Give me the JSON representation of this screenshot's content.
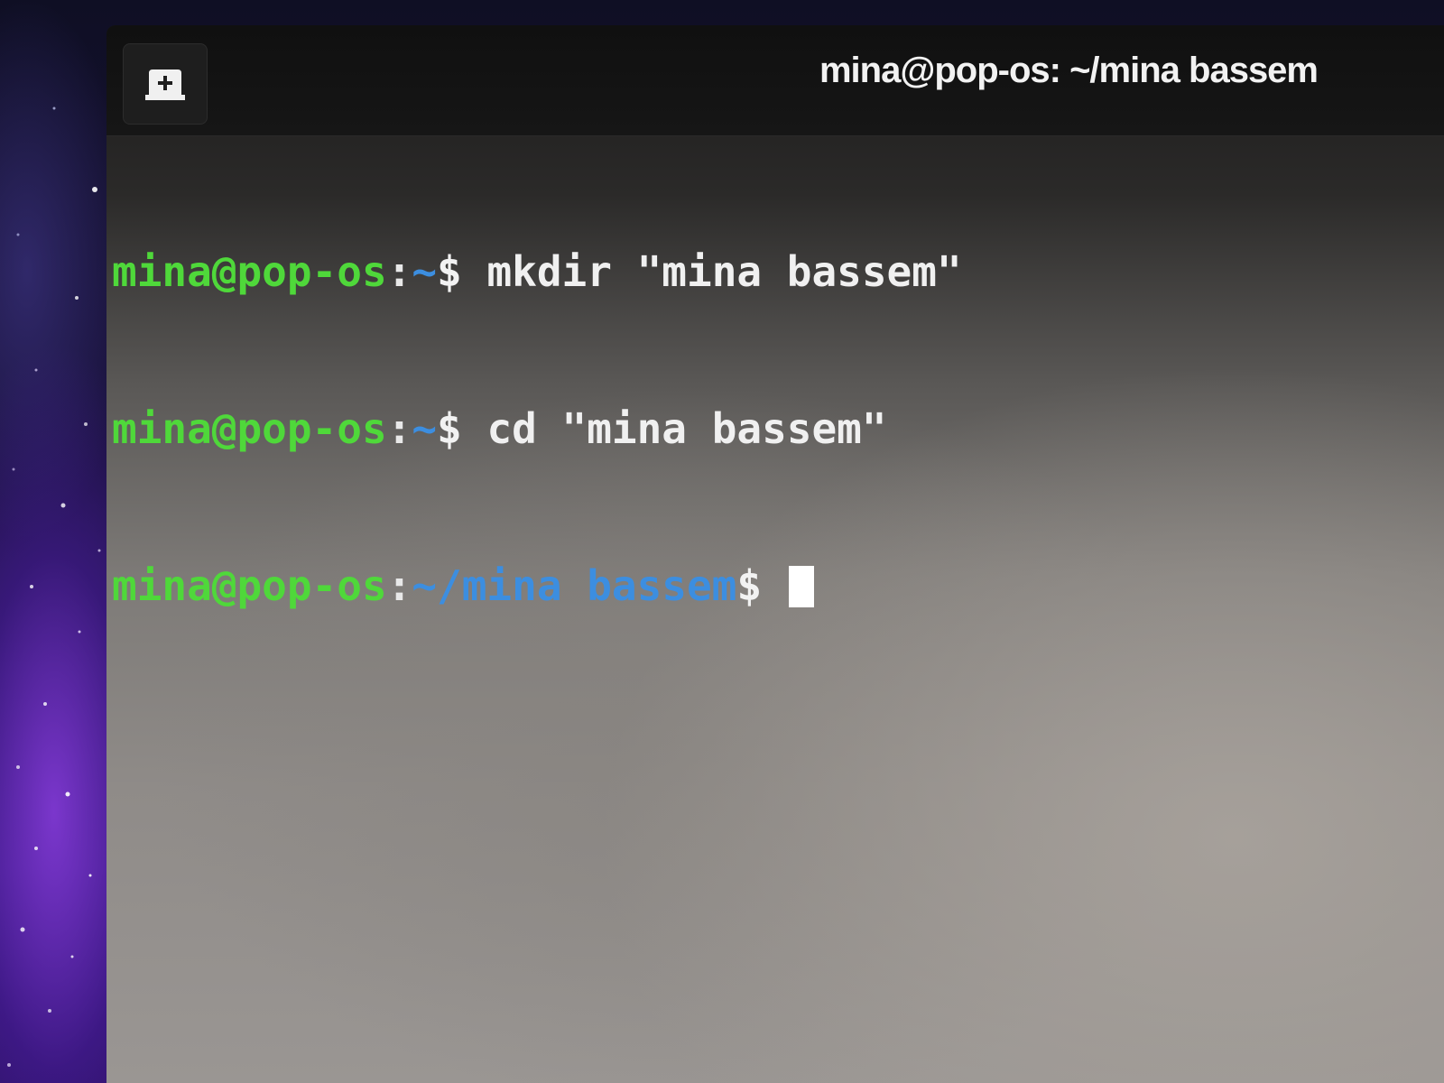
{
  "window": {
    "title": "mina@pop-os: ~/mina bassem"
  },
  "toolbar": {
    "new_tab_icon": "new-tab-icon"
  },
  "colors": {
    "prompt_user": "#4fd83a",
    "prompt_path": "#3c8ee0",
    "text": "#f0f0f0",
    "headerbar": "#101010"
  },
  "terminal": {
    "lines": [
      {
        "user": "mina@pop-os",
        "separator": ":",
        "path": "~",
        "symbol": "$",
        "command": " mkdir \"mina bassem\""
      },
      {
        "user": "mina@pop-os",
        "separator": ":",
        "path": "~",
        "symbol": "$",
        "command": " cd \"mina bassem\""
      },
      {
        "user": "mina@pop-os",
        "separator": ":",
        "path": "~/mina bassem",
        "symbol": "$",
        "command": " "
      }
    ]
  }
}
